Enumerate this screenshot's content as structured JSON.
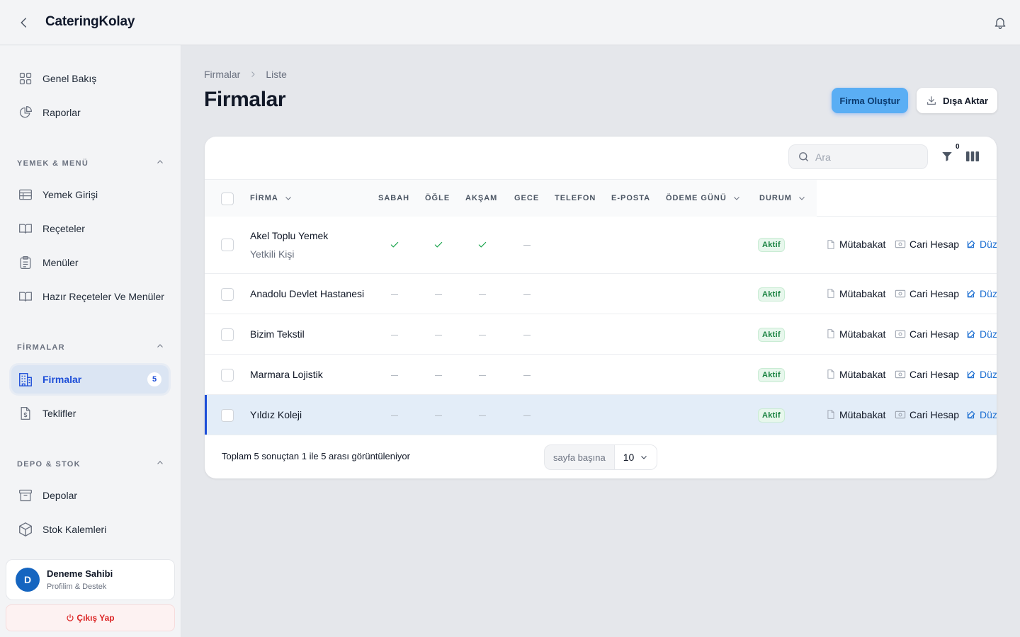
{
  "app": {
    "title": "CateringKolay"
  },
  "sidebar": {
    "top_items": [
      {
        "label": "Genel Bakış",
        "icon": "grid-icon"
      },
      {
        "label": "Raporlar",
        "icon": "pie-chart-icon"
      }
    ],
    "sections": [
      {
        "title": "YEMEK & MENÜ",
        "items": [
          "Yemek Girişi",
          "Reçeteler",
          "Menüler",
          "Hazır Reçeteler Ve Menüler"
        ]
      },
      {
        "title": "FİRMALAR",
        "items": [
          "Firmalar",
          "Teklifler"
        ]
      },
      {
        "title": "DEPO & STOK",
        "items": [
          "Depolar",
          "Stok Kalemleri"
        ]
      }
    ],
    "active_item": "Firmalar",
    "active_count": "5",
    "profile": {
      "initial": "D",
      "name": "Deneme Sahibi",
      "subtitle": "Profilim & Destek"
    },
    "logout_label": "Çıkış Yap"
  },
  "breadcrumb": [
    "Firmalar",
    "Liste"
  ],
  "page": {
    "title": "Firmalar",
    "create_button": "Firma Oluştur",
    "export_button": "Dışa Aktar"
  },
  "table": {
    "search_placeholder": "Ara",
    "filter_count": "0",
    "columns": [
      "FİRMA",
      "SABAH",
      "ÖĞLE",
      "AKŞAM",
      "GECE",
      "TELEFON",
      "E-POSTA",
      "ÖDEME GÜNÜ",
      "DURUM"
    ],
    "rows": [
      {
        "name": "Akel Toplu Yemek",
        "sub": "Yetkili Kişi",
        "meals": [
          "check",
          "check",
          "check",
          "dash"
        ],
        "status": "Aktif"
      },
      {
        "name": "Anadolu Devlet Hastanesi",
        "sub": "",
        "meals": [
          "dash",
          "dash",
          "dash",
          "dash"
        ],
        "status": "Aktif"
      },
      {
        "name": "Bizim Tekstil",
        "sub": "",
        "meals": [
          "dash",
          "dash",
          "dash",
          "dash"
        ],
        "status": "Aktif"
      },
      {
        "name": "Marmara Lojistik",
        "sub": "",
        "meals": [
          "dash",
          "dash",
          "dash",
          "dash"
        ],
        "status": "Aktif"
      },
      {
        "name": "Yıldız Koleji",
        "sub": "",
        "meals": [
          "dash",
          "dash",
          "dash",
          "dash"
        ],
        "status": "Aktif",
        "selected": true
      }
    ],
    "actions": [
      "Mütabakat",
      "Cari Hesap",
      "Düz"
    ],
    "footer_text": "Toplam 5 sonuçtan 1 ile 5 arası görüntüleniyor",
    "per_page_label": "sayfa başına",
    "per_page_value": "10"
  },
  "colors": {
    "accent": "#1d4ed8",
    "primary_button": "#5aaef4",
    "status_active": "#15803d",
    "danger": "#dc2626"
  }
}
